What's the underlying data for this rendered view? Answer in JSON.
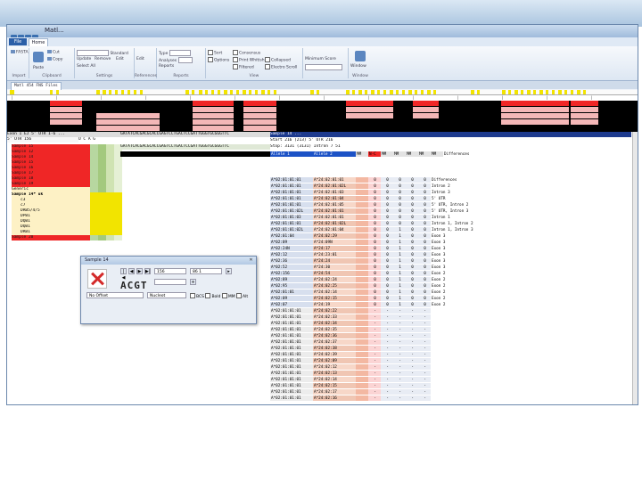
{
  "window": {
    "title": "Matl...",
    "file_tab": "File",
    "home_tab": "Home"
  },
  "ribbon": {
    "groups": [
      {
        "name": "Import",
        "items": [
          "FASTA"
        ]
      },
      {
        "name": "Clipboard",
        "items": [
          "Cut",
          "Copy",
          "Paste"
        ]
      },
      {
        "name": "Settings",
        "items": [
          "Standard",
          "Update",
          "Remove",
          "Select All",
          "Edit"
        ]
      },
      {
        "name": "References",
        "items": [
          "Edit"
        ]
      },
      {
        "name": "Reports",
        "items": [
          "Type",
          "Analyses",
          "Report",
          "Reports"
        ]
      },
      {
        "name": "View",
        "items": [
          "Sort",
          "Consensus",
          "Options",
          "Print Whitish",
          "Collapsed",
          "Filtered",
          "Electro Scroll"
        ]
      },
      {
        "name": "Window",
        "items": [
          "Window"
        ]
      }
    ],
    "minimum_score_label": "Minimum Score"
  },
  "tabs": [
    "Matl 454 FNS Files"
  ],
  "seq_ruler": "GATATCACGACGCACCGAGTCCTGACTCCGATTGGGTGCGGGTTC",
  "left_panel": {
    "header1": "Exon 1 EJ 5' UTR 1-6 ...",
    "header2": "5' UTR 156",
    "samples": [
      "Sample 15",
      "Sample 12",
      "Sample 14",
      "Sample 15",
      "Sample 16",
      "Sample 17",
      "Sample 18",
      "Sample 19"
    ],
    "generic_label": "Generic",
    "sample_info": "Sample 14* uk",
    "sub_items": [
      "c3",
      "c7",
      "DRB5/4/5",
      "DPB1",
      "DQB1",
      "DQB1",
      "DRB1"
    ],
    "last_sample": "Sample 20"
  },
  "grid": {
    "header_info": [
      "Sample 14 ...",
      "Start 216 (213) 5' UTR 216",
      "Stop: 3131 (3131) Intron 7 51"
    ],
    "headers": [
      "Allele 1",
      "Allele 2",
      "MM",
      "N-C",
      "MM",
      "MM",
      "MM",
      "MM",
      "MM",
      "Differences"
    ],
    "rows": [
      [
        "A*02:01:01:01",
        "A*24:02:01:01",
        "0",
        "0",
        "0",
        "0",
        "0",
        "Differences"
      ],
      [
        "A*02:01:01:01",
        "A*24:02:01:02L",
        "0",
        "0",
        "0",
        "0",
        "0",
        "Intron 2"
      ],
      [
        "A*02:01:01:01",
        "A*24:02:01:03",
        "0",
        "0",
        "0",
        "0",
        "0",
        "Intron 3"
      ],
      [
        "A*02:01:01:01",
        "A*24:02:01:04",
        "0",
        "0",
        "0",
        "0",
        "0",
        "5' UTR"
      ],
      [
        "A*02:01:01:01",
        "A*24:02:01:05",
        "0",
        "0",
        "0",
        "0",
        "0",
        "5' UTR, Intron 2"
      ],
      [
        "A*02:01:01:02L",
        "A*24:02:01:01",
        "0",
        "0",
        "0",
        "0",
        "0",
        "5' UTR, Intron 3"
      ],
      [
        "A*02:01:01:03",
        "A*24:02:01:01",
        "0",
        "0",
        "0",
        "0",
        "0",
        "Intron 1"
      ],
      [
        "A*02:01:01:01",
        "A*24:02:01:02L",
        "0",
        "0",
        "0",
        "0",
        "0",
        "Intron 1, Intron 2"
      ],
      [
        "A*02:01:01:02L",
        "A*24:02:01:04",
        "0",
        "0",
        "1",
        "0",
        "0",
        "Intron 1, Intron 3"
      ],
      [
        "A*02:01:04",
        "A*24:02:29",
        "0",
        "0",
        "1",
        "0",
        "0",
        "Exon 3"
      ],
      [
        "A*02:09",
        "A*24:09N",
        "0",
        "0",
        "1",
        "0",
        "0",
        "Exon 3"
      ],
      [
        "A*02:24N",
        "A*24:17",
        "0",
        "0",
        "1",
        "0",
        "0",
        "Exon 3"
      ],
      [
        "A*02:12",
        "A*24:23:01",
        "0",
        "0",
        "1",
        "0",
        "0",
        "Exon 3"
      ],
      [
        "A*02:36",
        "A*24:24",
        "0",
        "0",
        "1",
        "0",
        "0",
        "Exon 3"
      ],
      [
        "A*02:52",
        "A*24:30",
        "0",
        "0",
        "1",
        "0",
        "0",
        "Exon 3"
      ],
      [
        "A*02:156",
        "A*24:54",
        "0",
        "0",
        "1",
        "0",
        "0",
        "Exon 2"
      ],
      [
        "A*02:89",
        "A*24:02:24",
        "0",
        "0",
        "1",
        "0",
        "0",
        "Exon 2"
      ],
      [
        "A*02:95",
        "A*24:02:25",
        "0",
        "0",
        "1",
        "0",
        "0",
        "Exon 2"
      ],
      [
        "A*02:01:01",
        "A*24:02:14",
        "0",
        "0",
        "1",
        "0",
        "0",
        "Exon 2"
      ],
      [
        "A*02:09",
        "A*24:02:15",
        "0",
        "0",
        "1",
        "0",
        "0",
        "Exon 2"
      ],
      [
        "A*02:07",
        "A*24:19",
        "0",
        "0",
        "1",
        "0",
        "0",
        "Exon 2"
      ],
      [
        "A*02:01:01:01",
        "A*24:02:22",
        "-",
        "-",
        "-",
        "-",
        "-",
        ""
      ],
      [
        "A*02:01:01:01",
        "A*24:02:33",
        "-",
        "-",
        "-",
        "-",
        "-",
        ""
      ],
      [
        "A*02:01:01:01",
        "A*24:02:34",
        "-",
        "-",
        "-",
        "-",
        "-",
        ""
      ],
      [
        "A*02:01:01:01",
        "A*24:02:35",
        "-",
        "-",
        "-",
        "-",
        "-",
        ""
      ],
      [
        "A*02:01:01:01",
        "A*24:02:36",
        "-",
        "-",
        "-",
        "-",
        "-",
        ""
      ],
      [
        "A*02:01:01:01",
        "A*24:02:37",
        "-",
        "-",
        "-",
        "-",
        "-",
        ""
      ],
      [
        "A*02:01:01:01",
        "A*24:02:38",
        "-",
        "-",
        "-",
        "-",
        "-",
        ""
      ],
      [
        "A*02:01:01:01",
        "A*24:02:39",
        "-",
        "-",
        "-",
        "-",
        "-",
        ""
      ],
      [
        "A*02:01:01:01",
        "A*24:02:09",
        "-",
        "-",
        "-",
        "-",
        "-",
        ""
      ],
      [
        "A*02:01:01:01",
        "A*24:02:12",
        "-",
        "-",
        "-",
        "-",
        "-",
        ""
      ],
      [
        "A*02:01:01:01",
        "A*24:02:13",
        "-",
        "-",
        "-",
        "-",
        "-",
        ""
      ],
      [
        "A*02:01:01:01",
        "A*24:02:14",
        "-",
        "-",
        "-",
        "-",
        "-",
        ""
      ],
      [
        "A*02:01:01:01",
        "A*24:02:15",
        "-",
        "-",
        "-",
        "-",
        "-",
        ""
      ],
      [
        "A*02:01:01:01",
        "A*24:02:17",
        "-",
        "-",
        "-",
        "-",
        "-",
        ""
      ],
      [
        "A*02:01:01:01",
        "A*24:02:16",
        "-",
        "-",
        "-",
        "-",
        "-",
        ""
      ],
      [
        "A*02:01:01:01",
        "A*24:02:18",
        "-",
        "-",
        "-",
        "-",
        "-",
        ""
      ]
    ]
  },
  "dialog": {
    "title": "Sample 14",
    "acgt": "ACGT",
    "field1": "156",
    "field2": "86 1",
    "offset": "No Offset",
    "mode": "Nucleot",
    "checks": [
      "BCS",
      "Bold",
      "MM",
      "Alt"
    ]
  },
  "colors": {
    "red": "#ef2626",
    "yellow": "#f2e400",
    "salmon": "#f3b8a2",
    "cream": "#fdf1c5",
    "grey": "#bcbcbc"
  }
}
